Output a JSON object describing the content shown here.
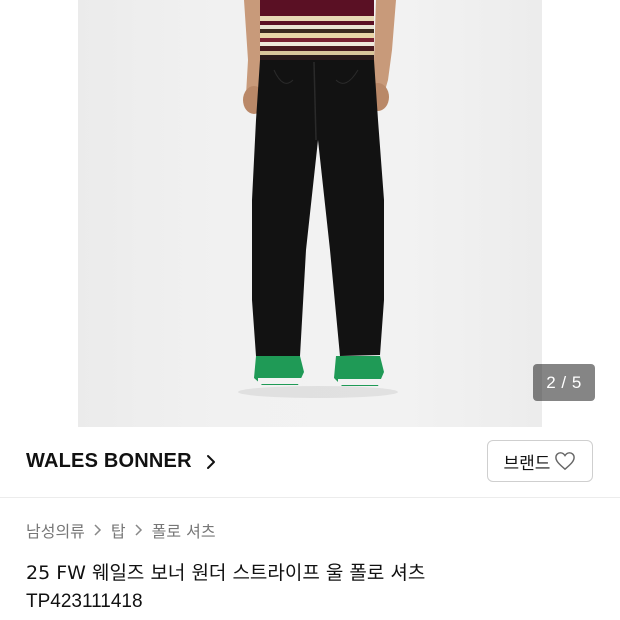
{
  "gallery": {
    "image_alt": "product photo",
    "counter": "2 / 5"
  },
  "brand": {
    "name": "WALES BONNER",
    "button_label": "브랜드"
  },
  "breadcrumb": {
    "items": [
      "남성의류",
      "탑",
      "폴로 셔츠"
    ]
  },
  "product": {
    "title": "25 FW 웨일즈 보너 원더 스트라이프 울 폴로 셔츠",
    "code": "TP423111418"
  },
  "icons": {
    "brand_chevron": "chevron-right-icon",
    "heart": "heart-outline-icon",
    "breadcrumb_sep": "chevron-right-icon"
  },
  "colors": {
    "text": "#111111",
    "muted": "#777777",
    "counter_bg": "rgba(0,0,0,0.48)"
  }
}
